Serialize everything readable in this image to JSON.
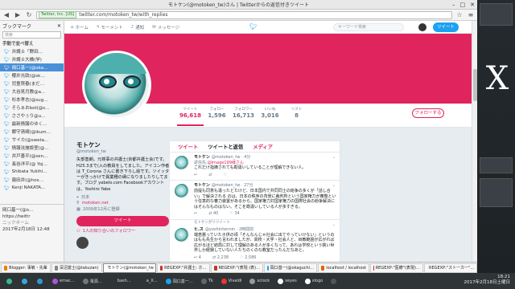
{
  "window": {
    "title": "モトケン(@motoken_tw)さん | Twitterからの返信付きツイート"
  },
  "browser": {
    "security_label": "Twitter, Inc. [US]",
    "url": "twitter.com/motoken_tw/with_replies"
  },
  "sidebar": {
    "title": "ブックマーク",
    "search_placeholder": "検索",
    "section": "手動で並べ替え",
    "items": [
      {
        "label": "弁護士「野田…",
        "selected": false
      },
      {
        "label": "弁護士大橋(学)",
        "selected": false
      },
      {
        "label": "岡口基一(@oka…",
        "selected": true
      },
      {
        "label": "櫻井光政(@sk…",
        "selected": false
      },
      {
        "label": "児童買春(まだ…",
        "selected": false
      },
      {
        "label": "大谷見月教@a…",
        "selected": false
      },
      {
        "label": "杉本孝志(@sug…",
        "selected": false
      },
      {
        "label": "そらぁおbot(@s…",
        "selected": false
      },
      {
        "label": "ささやぅり@u…",
        "selected": false
      },
      {
        "label": "最新情報のゆく…",
        "selected": false
      },
      {
        "label": "郷守清崎(@ikum…",
        "selected": false
      },
      {
        "label": "サイカ(@sweta…",
        "selected": false
      },
      {
        "label": "情報法施設室(@…",
        "selected": false
      },
      {
        "label": "井戸善平(@sen…",
        "selected": false
      },
      {
        "label": "長谷洋平(@ Yoj…",
        "selected": false
      },
      {
        "label": "Shibata Yukihi…",
        "selected": false
      },
      {
        "label": "霧田井(@hos…",
        "selected": false
      },
      {
        "label": "Kenji NAKATA…",
        "selected": false
      }
    ],
    "bottom_title": "岡口基一(@o…",
    "bottom_url": "https://twittr",
    "bottom_label": "ニックネーム",
    "bottom_date": "2017年2月18日 12:48"
  },
  "twitter_nav": {
    "home": "ホーム",
    "moments": "モーメント",
    "notifications": "通知",
    "messages": "メッセージ",
    "search_placeholder": "キーワード検索",
    "tweet_button": "ツイート"
  },
  "profile": {
    "stats": [
      {
        "label": "ツイート",
        "value": "96,618",
        "active": true
      },
      {
        "label": "フォロー",
        "value": "1,596",
        "active": false
      },
      {
        "label": "フォロワー",
        "value": "16,713",
        "active": false
      },
      {
        "label": "いいね",
        "value": "3,016",
        "active": false
      },
      {
        "label": "リスト",
        "value": "8",
        "active": false
      }
    ],
    "follow_button": "フォローする",
    "name": "モトケン",
    "handle": "@motoken_tw",
    "bio": "矢部善朗。元検事の弁護士(京都弁護士会)です。H25.3まで(入の教員をしてました。アイコン作者は T_Corona さんに書き下ろし絵です。ツイッターがきっかけで異業種の縁になりましたりしてます。ブログ yabelo.com Facebookアカウントは、Yoshiro Yabe",
    "location": "日本",
    "website": "motoken.net",
    "joined": "2009年12月に登録",
    "tweet_button": "ツイート",
    "followers_you_know": "1人の知り合いのフォロワー"
  },
  "timeline": {
    "tabs": [
      "ツイート",
      "ツイートと返信",
      "メディア"
    ],
    "tweets": [
      {
        "name": "モトケン",
        "handle": "@motoken_tw · 4分",
        "reply_prefix": "返信先:",
        "reply_user": "@Image199様さん",
        "text": "これだけ指摘されても勘違いしていることが理解できない人。",
        "acts": [
          "",
          "",
          ""
        ],
        "retweet": ""
      },
      {
        "name": "モトケン",
        "handle": "@motoken_tw · 27分",
        "reply_prefix": "",
        "reply_user": "",
        "text": "前提も同意も違ったとたけど、日本国内で共同同士の紛争の多くが「話し合い」で解決される のは、日本の秩序の背景に裁判所という国家権力が審整という任意的な審力装置があるから。国家権力対国家権力の国際社会の紛争解決にはそんなものはない。そこを勘違いしている人が多すぎる。",
        "acts": [
          "",
          "40",
          "34"
        ],
        "retweet": ""
      },
      {
        "name": "ヒ.ス",
        "handle": "@yoshintennin · 2時間前",
        "reply_prefix": "",
        "reply_user": "",
        "text": "端恵悪っていた子供の頃「そんなんじゃ社会に出てやっていけない」というのはもも先生から言われましたが、高校・大学・社会人と、目敵範囲が広がれば広がるほど結局に対して理解のある人が多くなって、あれは学校という狭い世界しか経験していない人たちのくのな教室だったんだなあと。",
        "acts": [
          "4",
          "2,238",
          "2,586"
        ],
        "retweet": "モトケンがリツイート"
      }
    ]
  },
  "taskbar": [
    {
      "label": "Blogger: 事敏・先輩",
      "color": "#f57d00",
      "active": false
    },
    {
      "label": "深沼富士(@takuzan)",
      "color": "#888",
      "active": false
    },
    {
      "label": "モトケン(@motoken_tw",
      "color": "#e66000",
      "active": true
    },
    {
      "label": "REGEXP:\"弁護士: ホ…",
      "color": "#c0392b",
      "active": false
    },
    {
      "label": "REGEXP:\"(表現 (表)…",
      "color": "#c0392b",
      "active": false
    },
    {
      "label": "岡口基一(@okaguchi…",
      "color": "#1da1f2",
      "active": false
    },
    {
      "label": "localhost / localhost",
      "color": "#e66000",
      "active": false
    },
    {
      "label": "REGEXP:\"医療\"(表現)…",
      "color": "#c0392b",
      "active": false
    },
    {
      "label": "REGEXP:\"ストーカー\"…",
      "color": "#c0392b",
      "active": false
    }
  ],
  "dock": [
    {
      "label": "",
      "color": "#3b8"
    },
    {
      "label": "",
      "color": "#3ad"
    },
    {
      "label": "",
      "color": "#39c"
    },
    {
      "label": "emac…",
      "color": "#a5d"
    },
    {
      "label": "電源…",
      "color": "#777"
    },
    {
      "label": "bash…",
      "color": "#333"
    },
    {
      "label": "a_X…",
      "color": "#333"
    },
    {
      "label": "岡口基一…",
      "color": "#1da1f2"
    },
    {
      "label": "Tk",
      "color": "#666"
    },
    {
      "label": "Vivaldi",
      "color": "#e33"
    },
    {
      "label": "xclock",
      "color": "#999"
    },
    {
      "label": "xeyes",
      "color": "#fff"
    },
    {
      "label": "xlogo",
      "color": "#fff"
    },
    {
      "label": "",
      "color": "#555"
    }
  ],
  "clock": {
    "time": "18:21",
    "date": "2017年2月18日土曜日"
  }
}
